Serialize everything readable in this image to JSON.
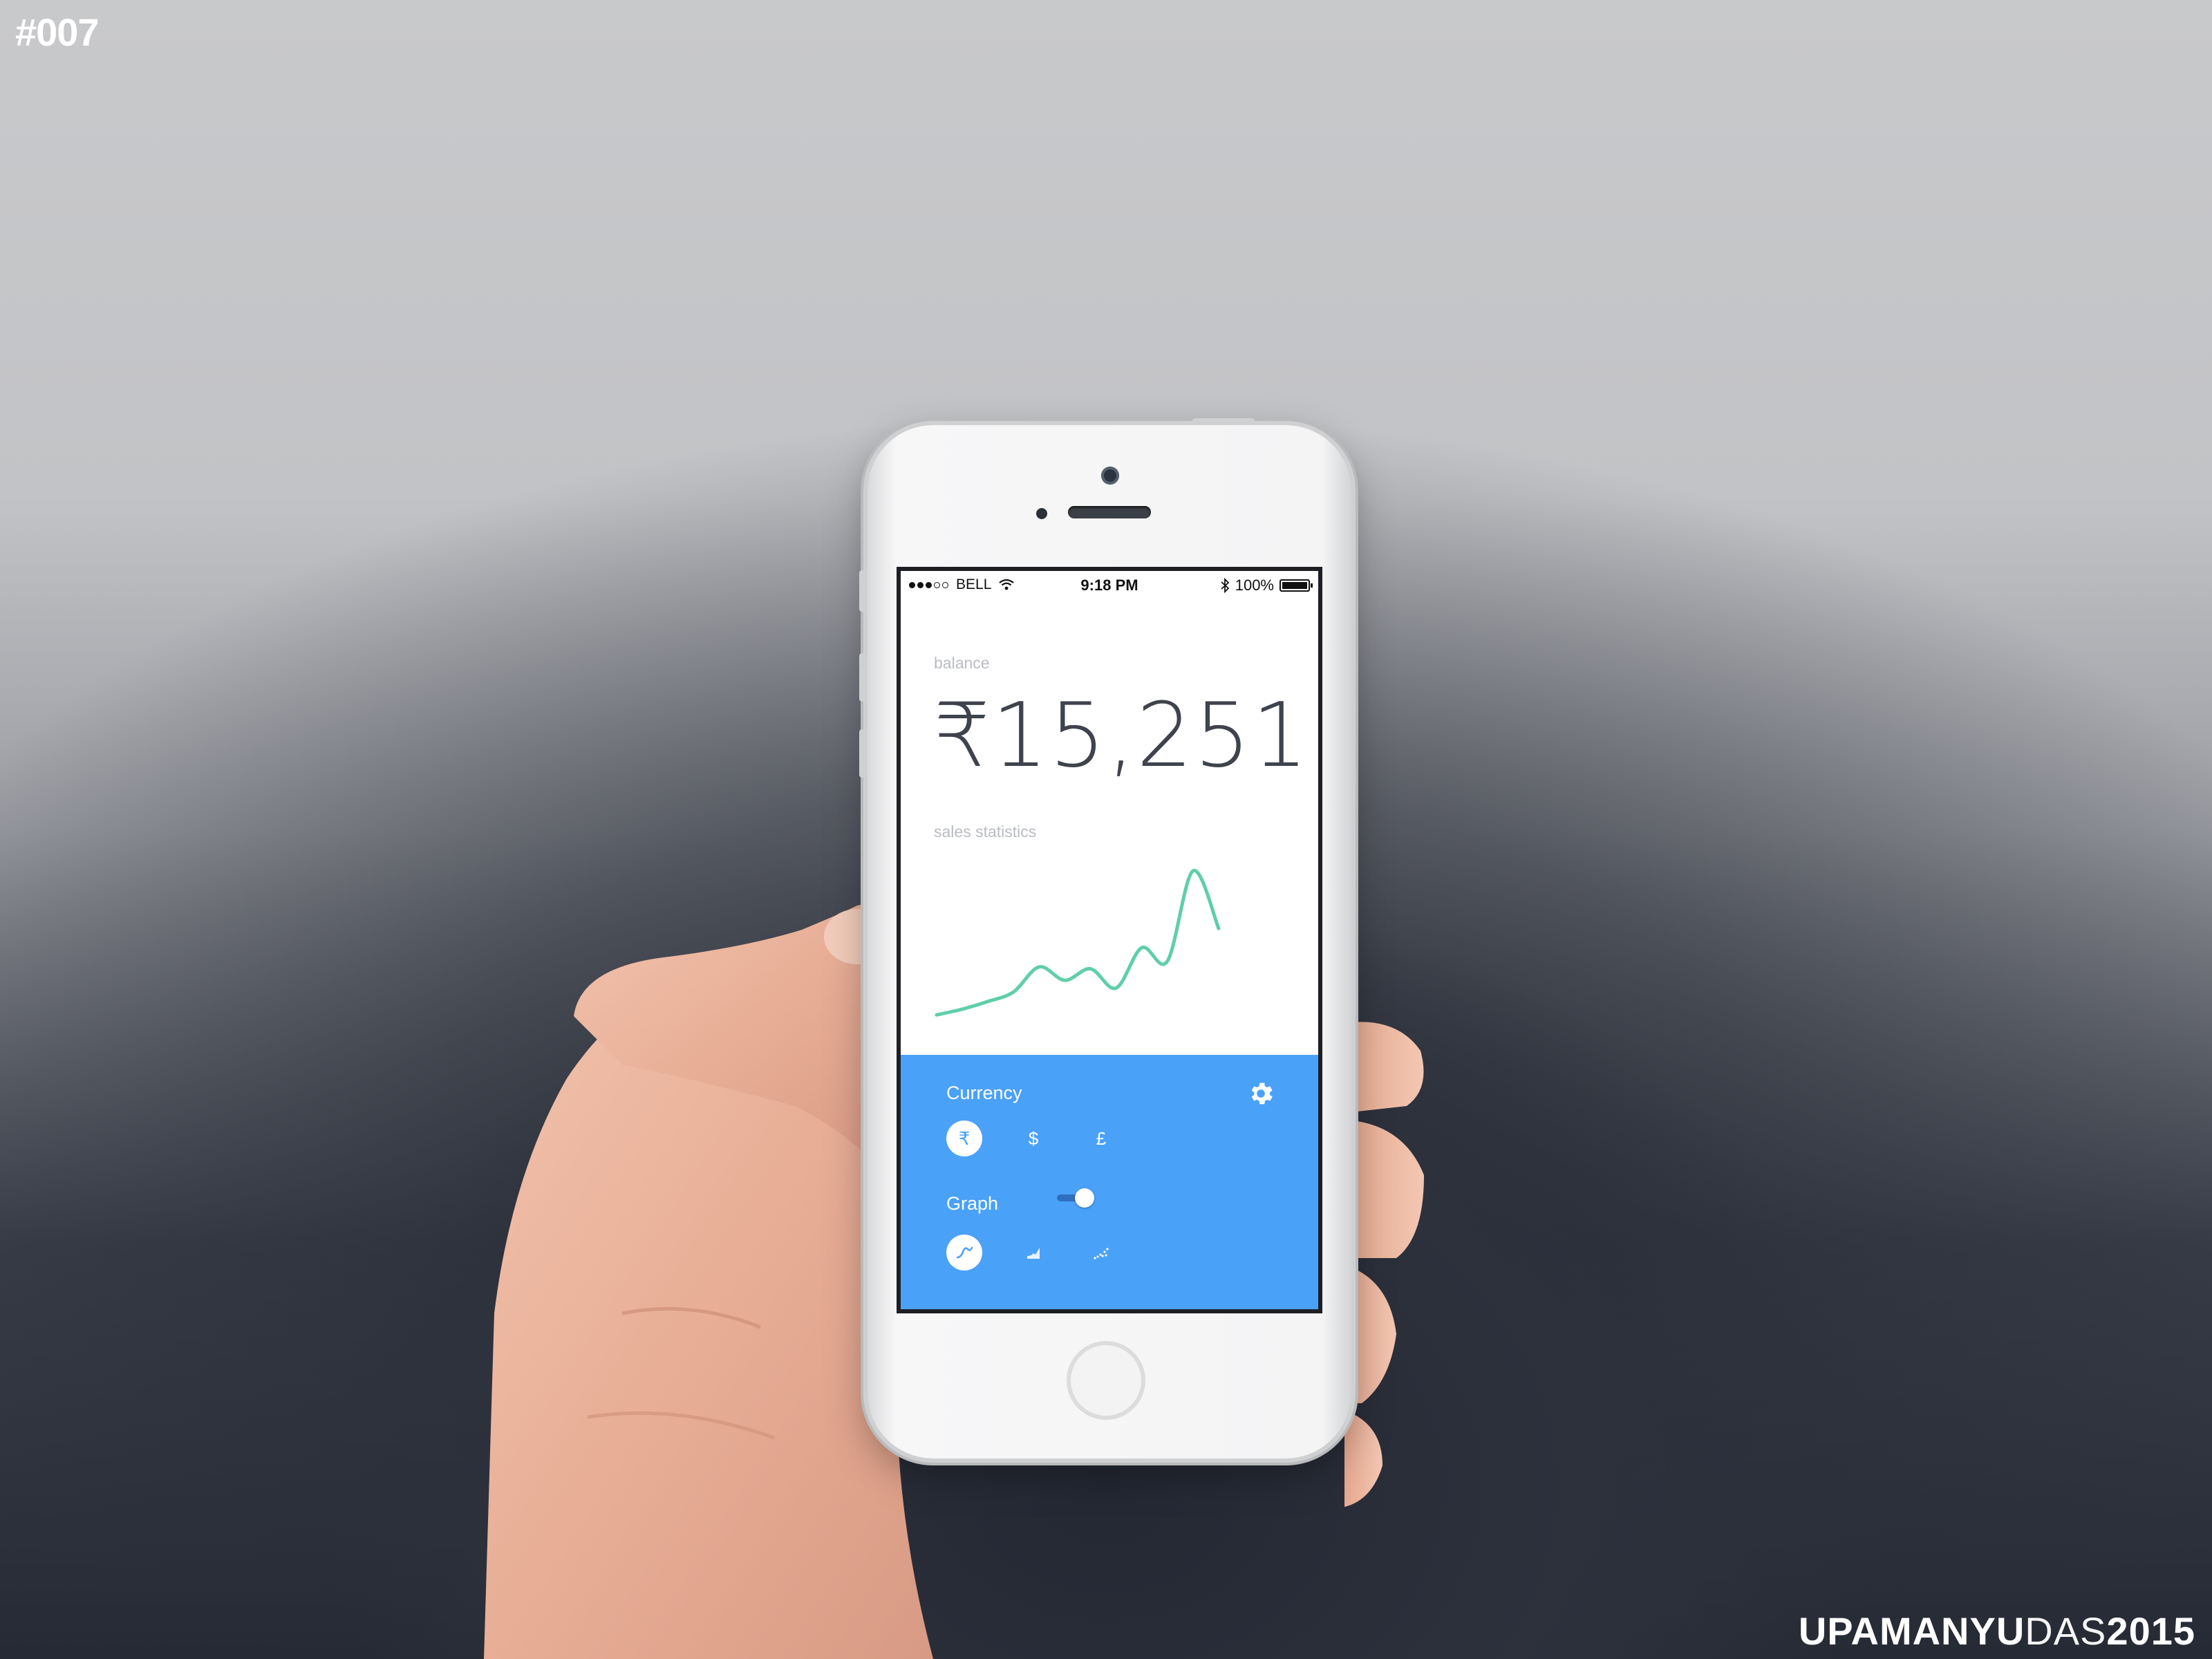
{
  "overlay": {
    "tag": "#007",
    "signature_bold": "UPAMANYU",
    "signature_light": "DAS",
    "signature_year": "2015"
  },
  "statusbar": {
    "carrier": "BELL",
    "time": "9:18 PM",
    "battery": "100%"
  },
  "balance": {
    "label": "balance",
    "value": "₹15,251"
  },
  "sales": {
    "label": "sales statistics"
  },
  "chart_data": {
    "type": "line",
    "title": "",
    "series": [
      {
        "values": [
          10,
          13,
          17,
          22,
          35,
          28,
          34,
          24,
          45,
          38,
          85,
          55
        ]
      }
    ],
    "color": "#5fcfa8"
  },
  "settings": {
    "currency_label": "Currency",
    "currency_options": [
      "₹",
      "$",
      "£"
    ],
    "currency_selected": "₹",
    "graph_label": "Graph",
    "graph_toggle_on": true,
    "graph_styles": [
      "line-graph-icon",
      "area-graph-icon",
      "scatter-graph-icon"
    ],
    "graph_selected": "line-graph-icon"
  },
  "colors": {
    "accent_blue": "#4aa1f8",
    "line_green": "#5fcfa8",
    "text_dark": "#3e434d"
  }
}
